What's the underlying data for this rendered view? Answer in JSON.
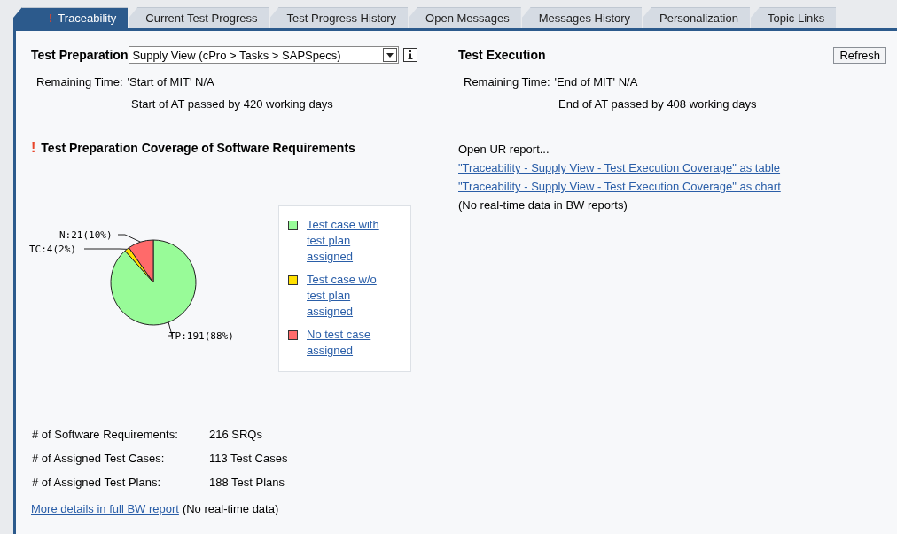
{
  "tabs": [
    {
      "label": "Traceability",
      "selected": true,
      "marker": "!"
    },
    {
      "label": "Current Test Progress",
      "selected": false
    },
    {
      "label": "Test Progress History",
      "selected": false
    },
    {
      "label": "Open Messages",
      "selected": false
    },
    {
      "label": "Messages History",
      "selected": false
    },
    {
      "label": "Personalization",
      "selected": false
    },
    {
      "label": "Topic Links",
      "selected": false
    }
  ],
  "preparation": {
    "title": "Test Preparation",
    "view_select": {
      "value": "Supply View (cPro > Tasks > SAPSpecs)"
    },
    "remaining_label": "Remaining Time:",
    "remaining_value": "'Start of MIT' N/A",
    "passed": "Start of AT passed by 420 working days"
  },
  "execution": {
    "title": "Test Execution",
    "refresh_button": "Refresh",
    "remaining_label": "Remaining Time:",
    "remaining_value": "'End of MIT' N/A",
    "passed": "End of AT passed by 408 working days"
  },
  "coverage": {
    "marker": "!",
    "title": "Test Preparation Coverage of Software Requirements",
    "chart_data": {
      "type": "pie",
      "values": [
        191,
        4,
        21
      ],
      "colors": [
        "#98fb98",
        "#ffe000",
        "#ff6a6a"
      ],
      "value_labels": [
        "TP:191(88%)",
        "TC:4(2%)",
        "N:21(10%)"
      ]
    },
    "legend": [
      {
        "label": "Test case with test plan assigned",
        "color": "#98fb98"
      },
      {
        "label": "Test case w/o test plan assigned",
        "color": "#ffe000"
      },
      {
        "label": "No test case assigned",
        "color": "#ff6a6a"
      }
    ]
  },
  "reports": {
    "heading": "Open UR report...",
    "links": [
      "\"Traceability - Supply View - Test Execution Coverage\" as table",
      "\"Traceability - Supply View - Test Execution Coverage\" as chart"
    ],
    "note": "(No real-time data in BW reports)"
  },
  "stats": [
    {
      "label": "# of Software Requirements:",
      "value": "216 SRQs"
    },
    {
      "label": "# of Assigned Test Cases:",
      "value": "113 Test Cases"
    },
    {
      "label": "# of Assigned Test Plans:",
      "value": "188 Test Plans"
    }
  ],
  "footer": {
    "link": "More details in full BW report",
    "note": "(No real-time data)"
  }
}
